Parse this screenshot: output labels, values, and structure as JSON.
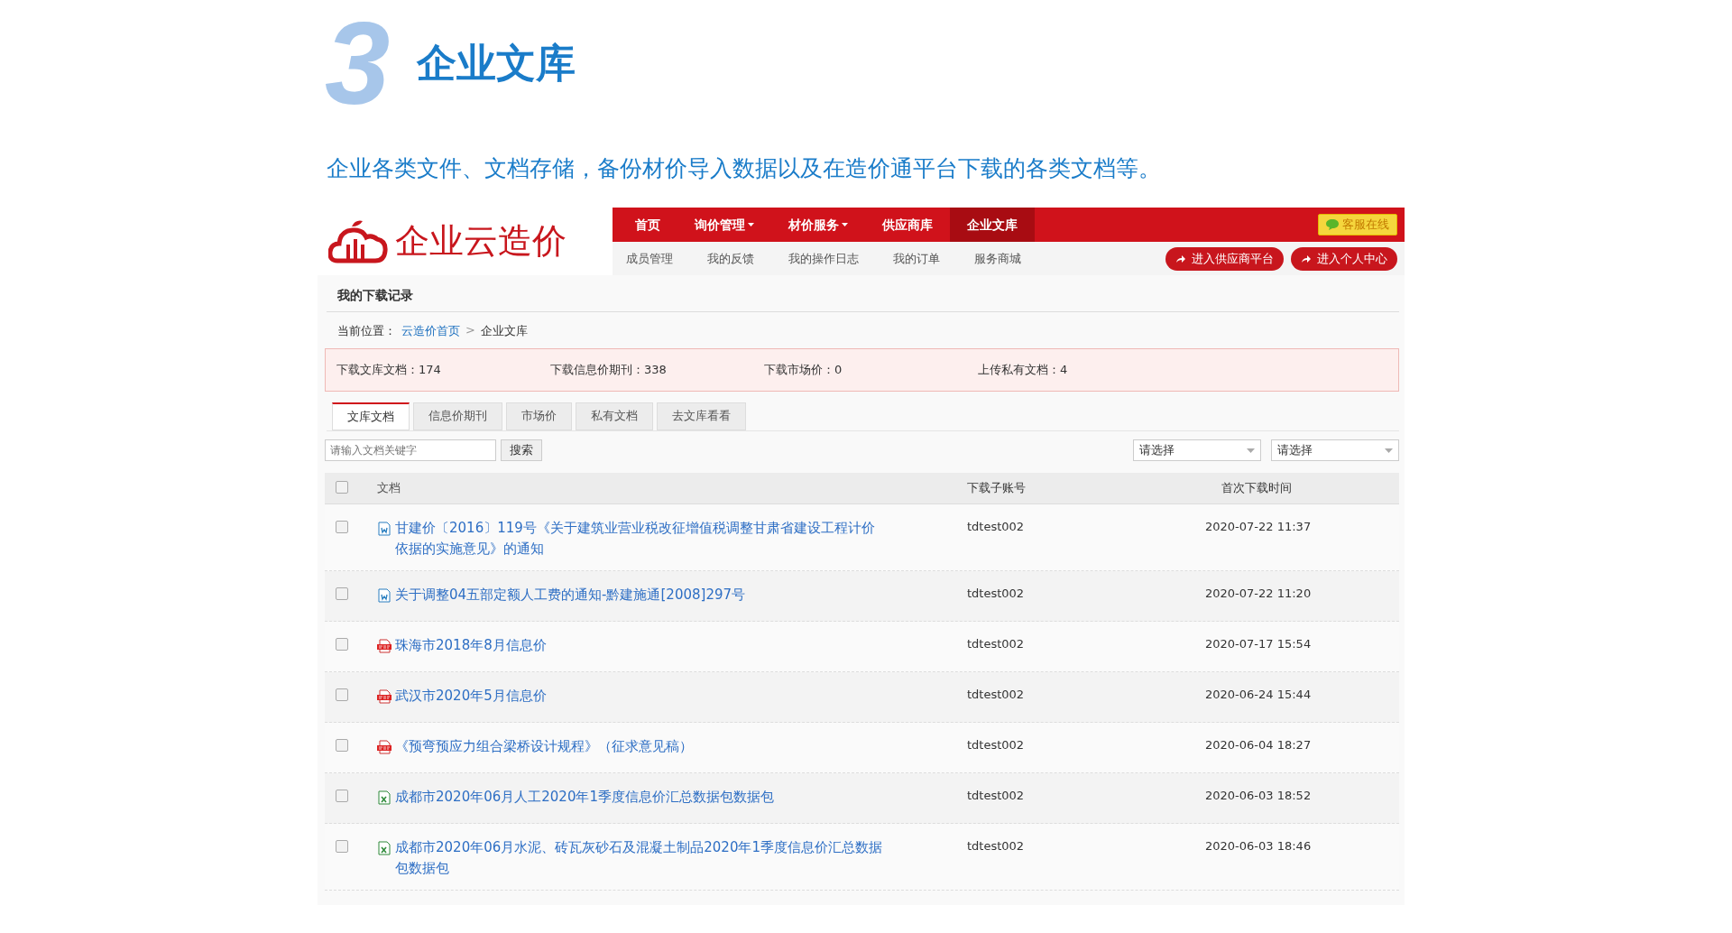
{
  "section": {
    "number": "3",
    "title": "企业文库",
    "subtitle": "企业各类文件、文档存储，备份材价导入数据以及在造价通平台下载的各类文档等。"
  },
  "app": {
    "logo": "企业云造价",
    "nav": [
      {
        "label": "首页",
        "selected": false,
        "dropdown": false
      },
      {
        "label": "询价管理",
        "selected": false,
        "dropdown": true
      },
      {
        "label": "材价服务",
        "selected": false,
        "dropdown": true
      },
      {
        "label": "供应商库",
        "selected": false,
        "dropdown": false
      },
      {
        "label": "企业文库",
        "selected": true,
        "dropdown": false
      }
    ],
    "service_badge": "客服在线",
    "subnav": [
      "成员管理",
      "我的反馈",
      "我的操作日志",
      "我的订单",
      "服务商城"
    ],
    "action_buttons": [
      "进入供应商平台",
      "进入个人中心"
    ],
    "page_heading": "我的下载记录",
    "breadcrumb": {
      "label": "当前位置：",
      "link": "云造价首页",
      "separator": ">",
      "current": "企业文库"
    },
    "stats": [
      "下载文库文档：174",
      "下载信息价期刊：338",
      "下载市场价：0",
      "上传私有文档：4"
    ],
    "tabs": [
      {
        "label": "文库文档",
        "selected": true
      },
      {
        "label": "信息价期刊",
        "selected": false
      },
      {
        "label": "市场价",
        "selected": false
      },
      {
        "label": "私有文档",
        "selected": false
      },
      {
        "label": "去文库看看",
        "selected": false
      }
    ],
    "search": {
      "placeholder": "请输入文档关键字",
      "button": "搜索"
    },
    "filters": [
      {
        "value": "请选择"
      },
      {
        "value": "请选择"
      }
    ],
    "table": {
      "select_all_checked": false,
      "columns": [
        "文档",
        "下载子账号",
        "首次下载时间"
      ],
      "rows": [
        {
          "checked": false,
          "kind": "word",
          "title": "甘建价〔2016〕119号《关于建筑业营业税改征增值税调整甘肃省建设工程计价依据的实施意见》的通知",
          "account": "tdtest002",
          "time": "2020-07-22 11:37"
        },
        {
          "checked": false,
          "kind": "word",
          "title": "关于调整04五部定额人工费的通知-黔建施通[2008]297号",
          "account": "tdtest002",
          "time": "2020-07-22 11:20"
        },
        {
          "checked": false,
          "kind": "pdf",
          "title": "珠海市2018年8月信息价",
          "account": "tdtest002",
          "time": "2020-07-17 15:54"
        },
        {
          "checked": false,
          "kind": "pdf",
          "title": "武汉市2020年5月信息价",
          "account": "tdtest002",
          "time": "2020-06-24 15:44"
        },
        {
          "checked": false,
          "kind": "pdf",
          "title": "《预弯预应力组合梁桥设计规程》（征求意见稿）",
          "account": "tdtest002",
          "time": "2020-06-04 18:27"
        },
        {
          "checked": false,
          "kind": "excel",
          "title": "成都市2020年06月人工2020年1季度信息价汇总数据包数据包",
          "account": "tdtest002",
          "time": "2020-06-03 18:52"
        },
        {
          "checked": false,
          "kind": "excel",
          "title": "成都市2020年06月水泥、砖瓦灰砂石及混凝土制品2020年1季度信息价汇总数据包数据包",
          "account": "tdtest002",
          "time": "2020-06-03 18:46"
        }
      ]
    }
  }
}
